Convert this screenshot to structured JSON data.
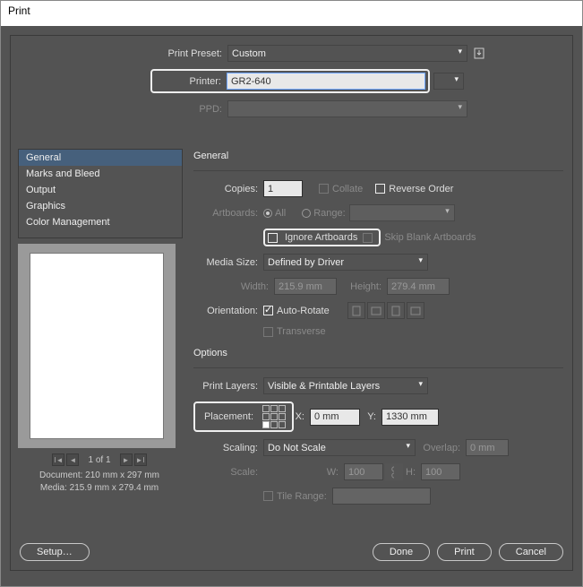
{
  "window": {
    "title": "Print"
  },
  "top": {
    "preset_label": "Print Preset:",
    "preset_value": "Custom",
    "printer_label": "Printer:",
    "printer_value": "GR2-640",
    "ppd_label": "PPD:"
  },
  "sidebar": {
    "items": [
      {
        "label": "General"
      },
      {
        "label": "Marks and Bleed"
      },
      {
        "label": "Output"
      },
      {
        "label": "Graphics"
      },
      {
        "label": "Color Management"
      }
    ],
    "pager": "1 of 1",
    "doc_line": "Document: 210 mm x 297 mm",
    "media_line": "Media:  215.9 mm x 279.4 mm"
  },
  "general": {
    "heading": "General",
    "copies_label": "Copies:",
    "copies_value": "1",
    "collate_label": "Collate",
    "reverse_label": "Reverse Order",
    "artboards_label": "Artboards:",
    "all_label": "All",
    "range_label": "Range:",
    "ignore_label": "Ignore Artboards",
    "skip_label": "Skip Blank Artboards",
    "mediasize_label": "Media Size:",
    "mediasize_value": "Defined by Driver",
    "width_label": "Width:",
    "width_value": "215.9 mm",
    "height_label": "Height:",
    "height_value": "279.4 mm",
    "orient_label": "Orientation:",
    "autorotate_label": "Auto-Rotate",
    "transverse_label": "Transverse"
  },
  "options": {
    "heading": "Options",
    "printlayers_label": "Print Layers:",
    "printlayers_value": "Visible & Printable Layers",
    "placement_label": "Placement:",
    "x_label": "X:",
    "x_value": "0 mm",
    "y_label": "Y:",
    "y_value": "1330 mm",
    "scaling_label": "Scaling:",
    "scaling_value": "Do Not Scale",
    "overlap_label": "Overlap:",
    "overlap_value": "0 mm",
    "scale_label": "Scale:",
    "w_label": "W:",
    "w_value": "100",
    "h_label": "H:",
    "h_value": "100",
    "tilerange_label": "Tile Range:"
  },
  "footer": {
    "setup": "Setup…",
    "done": "Done",
    "print": "Print",
    "cancel": "Cancel"
  }
}
